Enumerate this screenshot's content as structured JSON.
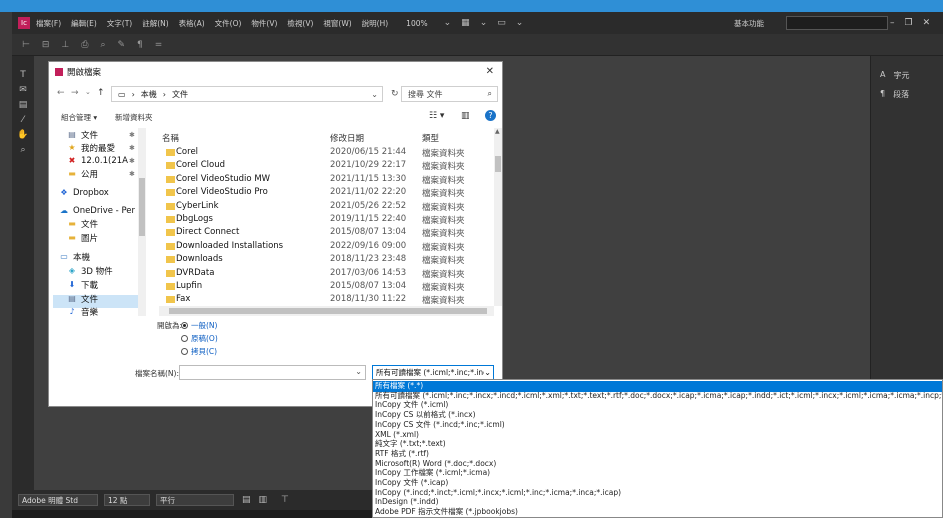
{
  "app": {
    "logo": "Ic",
    "menu": [
      "檔案(F)",
      "編輯(E)",
      "文字(T)",
      "註解(N)",
      "表格(A)",
      "文件(O)",
      "物件(V)",
      "檢視(V)",
      "視窗(W)",
      "說明(H)"
    ],
    "zoom": "100%",
    "workspace": "基本功能",
    "right_panel": [
      {
        "icon": "A",
        "label": "字元"
      },
      {
        "icon": "¶",
        "label": "段落"
      }
    ],
    "bottom": {
      "font": "Adobe 明體 Std",
      "size": "12 點",
      "style": "平行"
    }
  },
  "dialog": {
    "title": "開啟檔案",
    "path": [
      "本機",
      "文件"
    ],
    "search_placeholder": "搜尋 文件",
    "organize": "組合管理",
    "new_folder": "新增資料夾",
    "nav": [
      {
        "label": "文件",
        "icon": "doc",
        "pin": true
      },
      {
        "label": "我的最愛",
        "icon": "star",
        "pin": true
      },
      {
        "label": "12.0.1(21A",
        "icon": "x",
        "pin": true
      },
      {
        "label": "公用",
        "icon": "folder",
        "pin": true
      },
      {
        "label": "Dropbox",
        "icon": "dropbox"
      },
      {
        "label": "OneDrive - Per",
        "icon": "cloud"
      },
      {
        "label": "文件",
        "icon": "folder"
      },
      {
        "label": "圖片",
        "icon": "folder"
      },
      {
        "label": "本機",
        "icon": "pc"
      },
      {
        "label": "3D 物件",
        "icon": "cube"
      },
      {
        "label": "下載",
        "icon": "download"
      },
      {
        "label": "文件",
        "icon": "doc",
        "selected": true
      },
      {
        "label": "音樂",
        "icon": "music"
      }
    ],
    "columns": {
      "name": "名稱",
      "date": "修改日期",
      "type": "類型"
    },
    "files": [
      {
        "name": "Corel",
        "date": "2020/06/15 21:44",
        "type": "檔案資料夾"
      },
      {
        "name": "Corel Cloud",
        "date": "2021/10/29 22:17",
        "type": "檔案資料夾"
      },
      {
        "name": "Corel VideoStudio MW",
        "date": "2021/11/15 13:30",
        "type": "檔案資料夾"
      },
      {
        "name": "Corel VideoStudio Pro",
        "date": "2021/11/02 22:20",
        "type": "檔案資料夾"
      },
      {
        "name": "CyberLink",
        "date": "2021/05/26 22:52",
        "type": "檔案資料夾"
      },
      {
        "name": "DbgLogs",
        "date": "2019/11/15 22:40",
        "type": "檔案資料夾"
      },
      {
        "name": "Direct Connect",
        "date": "2015/08/07 13:04",
        "type": "檔案資料夾"
      },
      {
        "name": "Downloaded Installations",
        "date": "2022/09/16 09:00",
        "type": "檔案資料夾"
      },
      {
        "name": "Downloads",
        "date": "2018/11/23 23:48",
        "type": "檔案資料夾"
      },
      {
        "name": "DVRData",
        "date": "2017/03/06 14:53",
        "type": "檔案資料夾"
      },
      {
        "name": "Lupfin",
        "date": "2015/08/07 13:04",
        "type": "檔案資料夾"
      },
      {
        "name": "Fax",
        "date": "2018/11/30 11:22",
        "type": "檔案資料夾"
      }
    ],
    "open_as_label": "開啟為:",
    "open_as": [
      {
        "label": "一般(N)",
        "on": true
      },
      {
        "label": "原稿(O)",
        "on": false
      },
      {
        "label": "拷貝(C)",
        "on": false
      }
    ],
    "filename_label": "檔案名稱(N):",
    "filetype_selected": "所有可讀檔案 (*.icml;*.inc;*.inc"
  },
  "dropdown": [
    {
      "label": "所有檔案 (*.*)",
      "selected": true
    },
    {
      "label": "所有可讀檔案 (*.icml;*.inc;*.incx;*.incd;*.icml;*.xml;*.txt;*.text;*.rtf;*.doc;*.docx;*.icap;*.icma;*.icap;*.indd;*.ict;*.icml;*.incx;*.icml;*.icma;*.icma;*.incp;*.icap;*.indd;*.jpeg"
    },
    {
      "label": "InCopy 文件 (*.icml)"
    },
    {
      "label": "InCopy CS 以前格式 (*.incx)"
    },
    {
      "label": "InCopy CS 文件 (*.incd;*.inc;*.icml)"
    },
    {
      "label": "XML (*.xml)"
    },
    {
      "label": "純文字 (*.txt;*.text)"
    },
    {
      "label": "RTF 格式 (*.rtf)"
    },
    {
      "label": "Microsoft(R) Word (*.doc;*.docx)"
    },
    {
      "label": "InCopy 工作檔案 (*.icml;*.icma)"
    },
    {
      "label": "InCopy 文件 (*.icap)"
    },
    {
      "label": "InCopy (*.incd;*.inct;*.icml;*.incx;*.icml;*.inc;*.icma;*.inca;*.icap)"
    },
    {
      "label": "InDesign (*.indd)"
    },
    {
      "label": "Adobe PDF 指示文件檔案 (*.jpbookjobs)"
    }
  ]
}
